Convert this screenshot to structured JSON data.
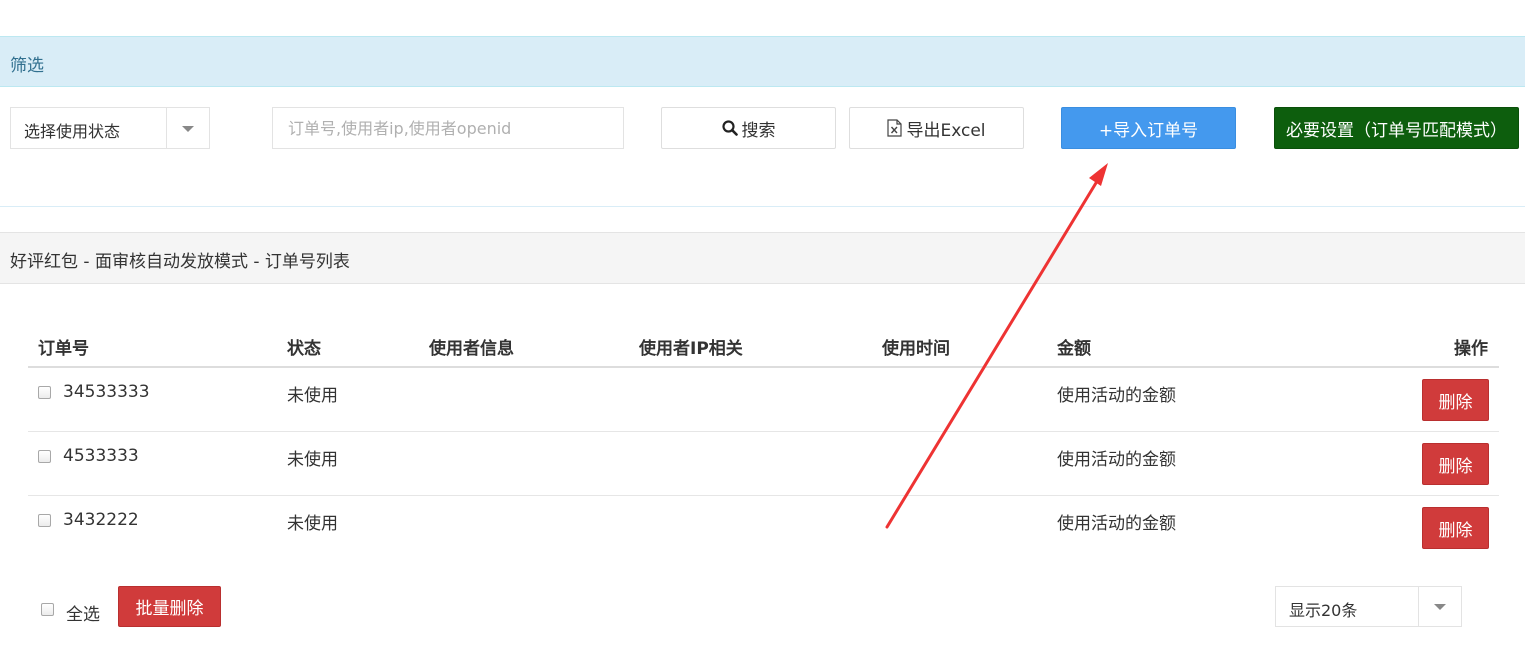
{
  "filter": {
    "title": "筛选",
    "status_select": {
      "value": "选择使用状态"
    },
    "search": {
      "placeholder": "订单号,使用者ip,使用者openid",
      "value": ""
    },
    "buttons": {
      "search": "搜索",
      "export": "导出Excel",
      "import": "+导入订单号",
      "settings": "必要设置（订单号匹配模式）"
    }
  },
  "list": {
    "title": "好评红包 - 面审核自动发放模式 - 订单号列表",
    "columns": [
      "订单号",
      "状态",
      "使用者信息",
      "使用者IP相关",
      "使用时间",
      "金额",
      "操作"
    ],
    "rows": [
      {
        "order_no": "34533333",
        "status": "未使用",
        "user_info": "",
        "user_ip": "",
        "use_time": "",
        "amount": "使用活动的金额",
        "action": "删除"
      },
      {
        "order_no": "4533333",
        "status": "未使用",
        "user_info": "",
        "user_ip": "",
        "use_time": "",
        "amount": "使用活动的金额",
        "action": "删除"
      },
      {
        "order_no": "3432222",
        "status": "未使用",
        "user_info": "",
        "user_ip": "",
        "use_time": "",
        "amount": "使用活动的金额",
        "action": "删除"
      }
    ]
  },
  "footer": {
    "select_all_label": "全选",
    "batch_delete_label": "批量删除",
    "page_size": {
      "value": "显示20条"
    }
  },
  "colors": {
    "filter_header_bg": "#d9edf7",
    "import_button": "#4499ee",
    "settings_button": "#0d5e0d",
    "delete_button": "#d03b3b",
    "annotation_arrow": "#ee3333"
  },
  "icons": {
    "search_button": "search-icon",
    "export_button": "excel-file-icon",
    "dropdown": "caret-down-icon"
  }
}
